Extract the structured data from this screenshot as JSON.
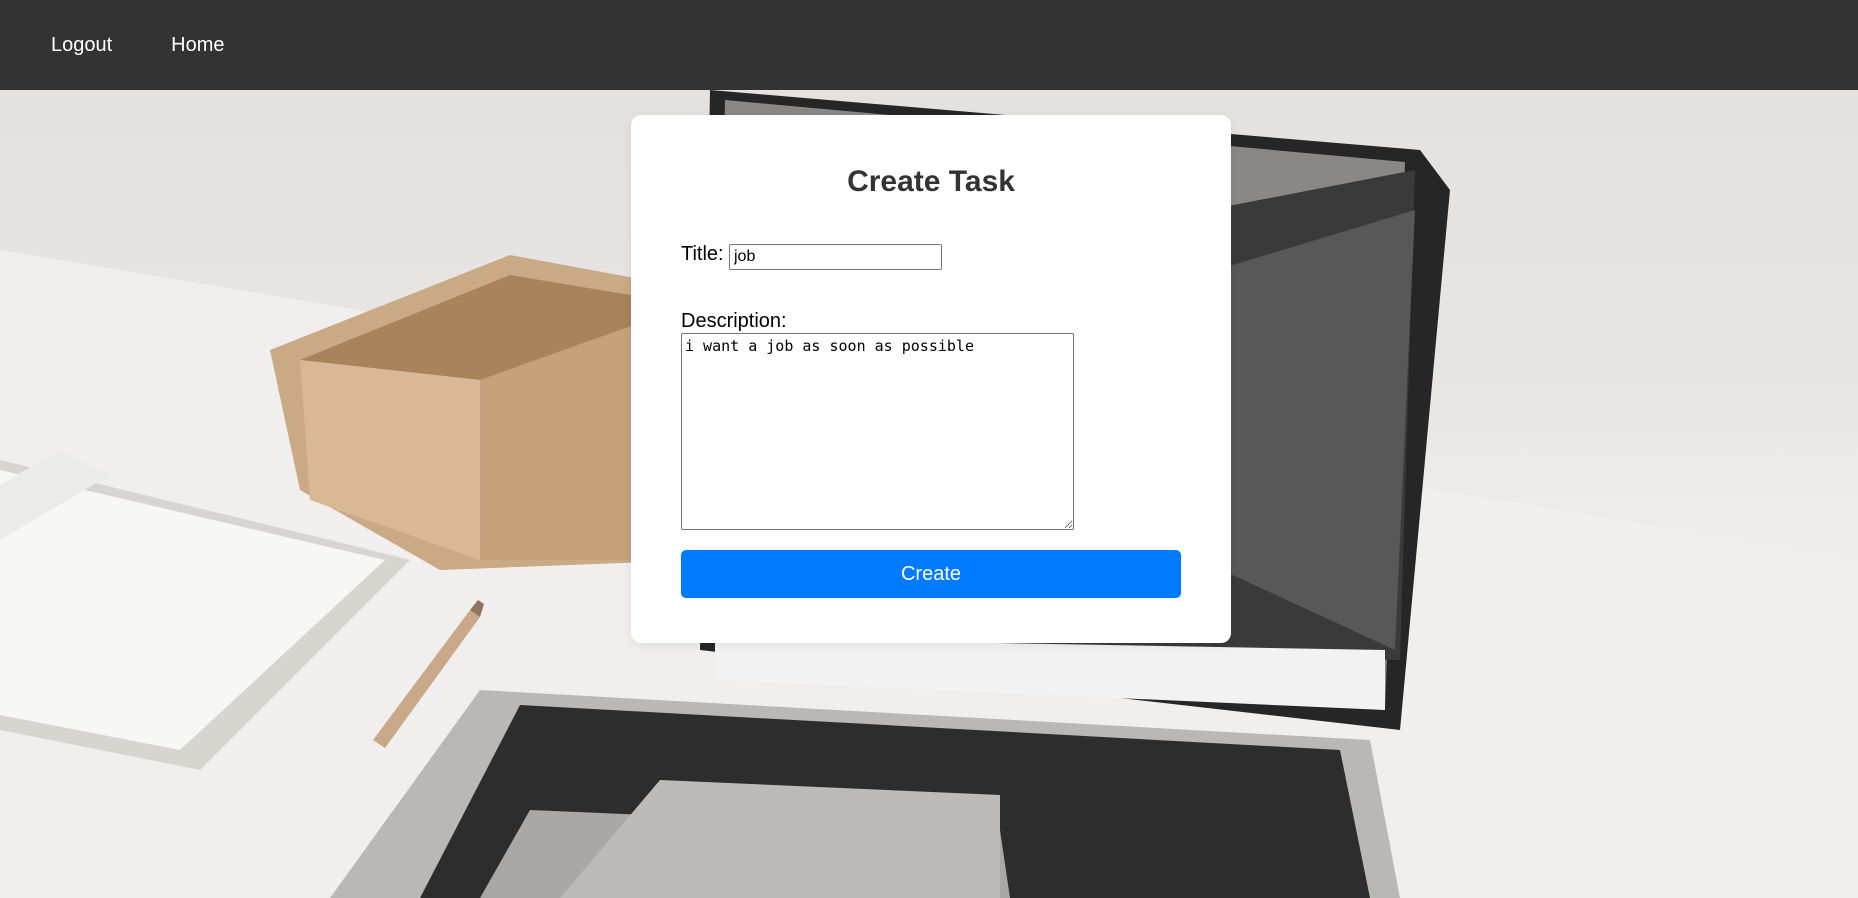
{
  "nav": {
    "logout_label": "Logout",
    "home_label": "Home"
  },
  "form": {
    "heading": "Create Task",
    "title_label": "Title:",
    "title_value": "job",
    "description_label": "Description:",
    "description_value": "i want a job as soon as possible",
    "submit_label": "Create"
  },
  "colors": {
    "navbar": "#333333",
    "primary_button": "#007bff"
  }
}
